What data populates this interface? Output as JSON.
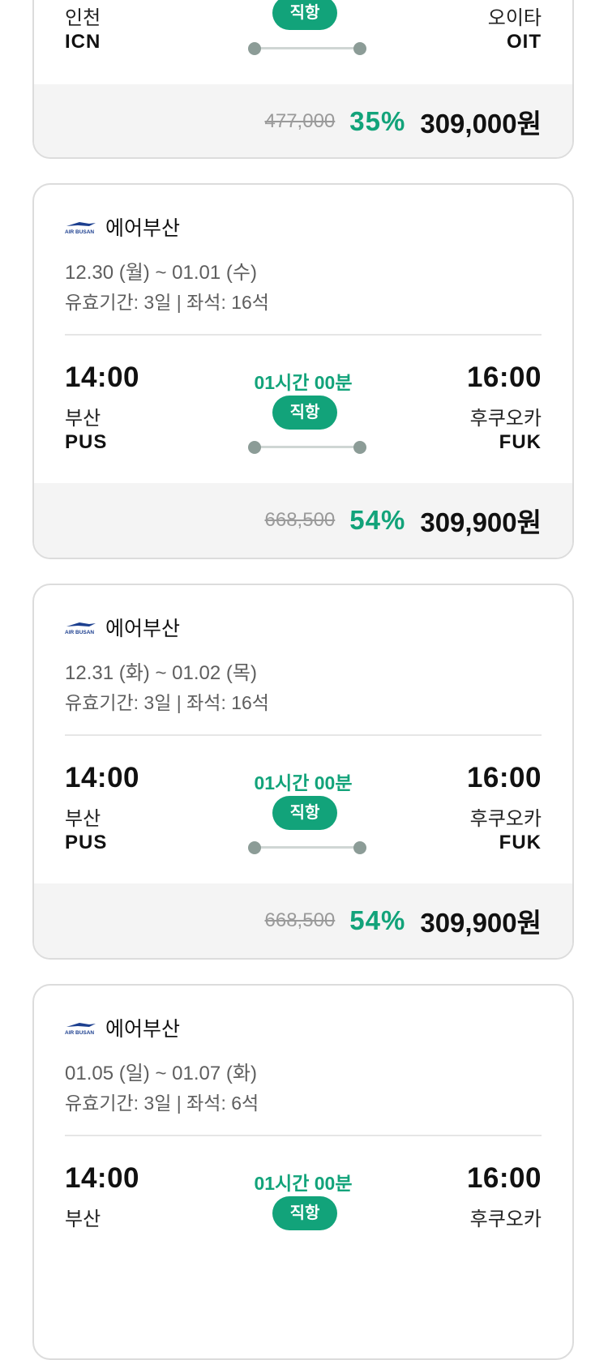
{
  "colors": {
    "accent": "#12a37a",
    "muted": "#5e5e5e",
    "price_bg": "#f4f4f4"
  },
  "icons": {
    "airline_logo": "air-busan-logo",
    "route": "route-line-dots"
  },
  "top_card": {
    "dep_city": "인천",
    "dep_code": "ICN",
    "arr_city": "오이타",
    "arr_code": "OIT",
    "badge": "직항",
    "orig_price": "477,000",
    "discount": "35%",
    "final_price": "309,000원"
  },
  "cards": [
    {
      "airline": "에어부산",
      "dates": "12.30 (월) ~ 01.01 (수)",
      "validity": "유효기간: 3일 | 좌석: 16석",
      "dep_time": "14:00",
      "arr_time": "16:00",
      "duration": "01시간 00분",
      "badge": "직항",
      "dep_city": "부산",
      "dep_code": "PUS",
      "arr_city": "후쿠오카",
      "arr_code": "FUK",
      "orig_price": "668,500",
      "discount": "54%",
      "final_price": "309,900원"
    },
    {
      "airline": "에어부산",
      "dates": "12.31 (화) ~ 01.02 (목)",
      "validity": "유효기간: 3일 | 좌석: 16석",
      "dep_time": "14:00",
      "arr_time": "16:00",
      "duration": "01시간 00분",
      "badge": "직항",
      "dep_city": "부산",
      "dep_code": "PUS",
      "arr_city": "후쿠오카",
      "arr_code": "FUK",
      "orig_price": "668,500",
      "discount": "54%",
      "final_price": "309,900원"
    },
    {
      "airline": "에어부산",
      "dates": "01.05 (일) ~ 01.07 (화)",
      "validity": "유효기간: 3일 | 좌석: 6석",
      "dep_time": "14:00",
      "arr_time": "16:00",
      "duration": "01시간 00분",
      "badge": "직항",
      "dep_city": "부산",
      "arr_city": "후쿠오카"
    }
  ]
}
